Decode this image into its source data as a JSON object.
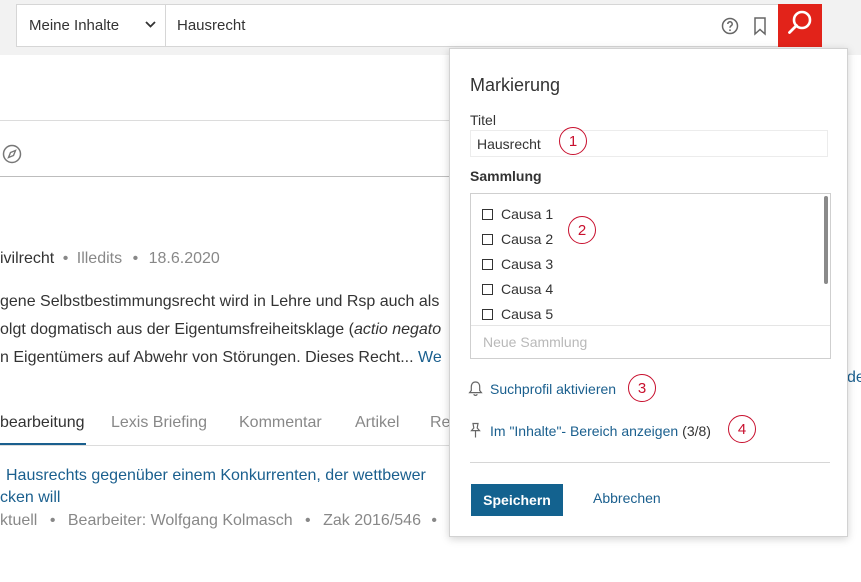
{
  "search": {
    "scope_label": "Meine Inhalte",
    "query": "Hausrecht"
  },
  "background": {
    "meta": {
      "area": "ivilrecht",
      "sep1": "•",
      "source": "Illedits",
      "sep2": "•",
      "date": "18.6.2020"
    },
    "text_lines": [
      "gene Selbstbestimmungsrecht wird in Lehre und Rsp auch als",
      "olgt dogmatisch aus der Eigentumsfreiheitsklage (",
      "n Eigentümers auf Abwehr von Störungen. Dieses Recht... "
    ],
    "italic_fragment": "actio negato",
    "more_link": "We",
    "edge_link": "de",
    "tabs": [
      "bearbeitung",
      "Lexis Briefing",
      "Kommentar",
      "Artikel",
      "Re"
    ],
    "result_title_line1": "Hausrechts gegenüber einem Konkurrenten, der wettbewer",
    "result_title_line2": "cken will",
    "result_meta": {
      "status": "ktuell",
      "sep1": "•",
      "editor": "Bearbeiter: Wolfgang Kolmasch",
      "sep2": "•",
      "ref": "Zak 2016/546",
      "sep3": "•"
    }
  },
  "popup": {
    "heading": "Markierung",
    "title_label": "Titel",
    "title_value": "Hausrecht",
    "collection_label": "Sammlung",
    "collections": [
      "Causa 1",
      "Causa 2",
      "Causa 3",
      "Causa 4",
      "Causa 5"
    ],
    "new_collection_placeholder": "Neue Sammlung",
    "search_profile_label": "Suchprofil aktivieren",
    "pin_label": "Im \"Inhalte\"- Bereich anzeigen",
    "pin_count": "(3/8)",
    "save_label": "Speichern",
    "cancel_label": "Abbrechen"
  },
  "badges": [
    "1",
    "2",
    "3",
    "4"
  ],
  "colors": {
    "brand_red": "#e2231a",
    "link_blue": "#1a5f8e",
    "save_blue": "#13628f",
    "badge_red": "#c8102e"
  },
  "icons": [
    "chevron-down-icon",
    "help-icon",
    "bookmark-icon",
    "search-icon",
    "compass-icon",
    "bell-icon",
    "pin-icon"
  ]
}
